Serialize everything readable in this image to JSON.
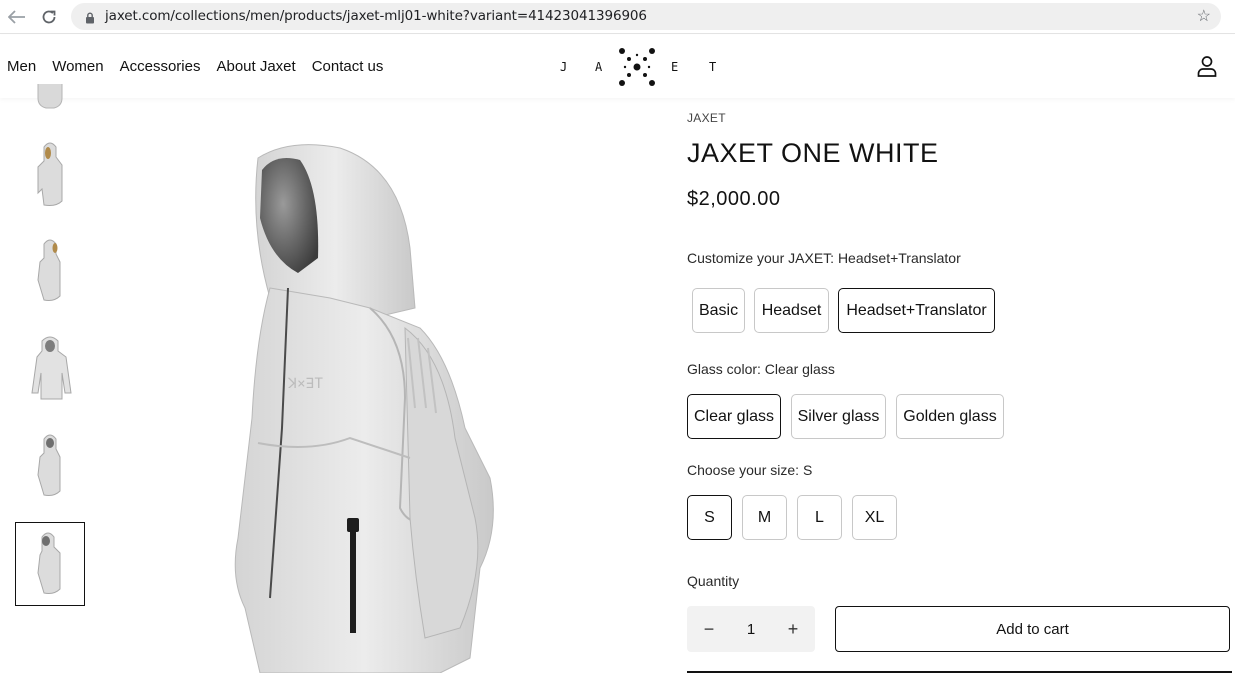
{
  "browser": {
    "url": "jaxet.com/collections/men/products/jaxet-mlj01-white?variant=41423041396906",
    "back_icon": "back-arrow-icon",
    "forward_icon": "forward-arrow-icon",
    "reload_icon": "reload-icon",
    "bookmark_icon": "star-icon"
  },
  "header": {
    "menu": [
      "Men",
      "Women",
      "Accessories",
      "About Jaxet",
      "Contact us"
    ],
    "logo_letters": [
      "J",
      "A",
      "E",
      "T"
    ],
    "account_icon": "account-icon"
  },
  "product": {
    "vendor": "JAXET",
    "title": "JAXET ONE WHITE",
    "price": "$2,000.00"
  },
  "options": {
    "customize_label": "Customize your JAXET: Headset+Translator",
    "customize_values": [
      "Basic",
      "Headset",
      "Headset+Translator"
    ],
    "customize_selected": "Headset+Translator",
    "glass_label": "Glass color: Clear glass",
    "glass_values": [
      "Clear glass",
      "Silver glass",
      "Golden glass"
    ],
    "glass_selected": "Clear glass",
    "size_label": "Choose your size: S",
    "size_values": [
      "S",
      "M",
      "L",
      "XL"
    ],
    "size_selected": "S"
  },
  "quantity": {
    "label": "Quantity",
    "value": "1",
    "minus": "−",
    "plus": "+"
  },
  "cart": {
    "add_label": "Add to cart"
  },
  "colors": {
    "text": "#121212",
    "border": "#c8c8c8",
    "qty_bg": "#f2f2f2"
  }
}
